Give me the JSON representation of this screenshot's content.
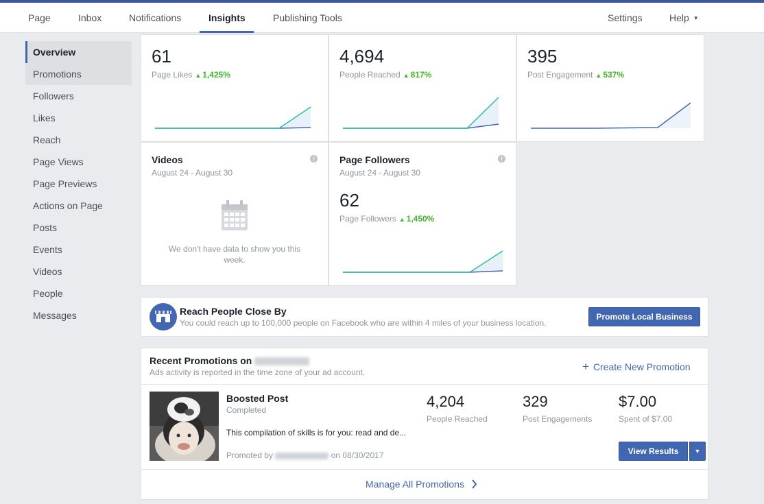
{
  "nav": {
    "items": [
      "Page",
      "Inbox",
      "Notifications",
      "Insights",
      "Publishing Tools"
    ],
    "right": [
      "Settings",
      "Help"
    ]
  },
  "sidebar": {
    "items": [
      "Overview",
      "Promotions",
      "Followers",
      "Likes",
      "Reach",
      "Page Views",
      "Page Previews",
      "Actions on Page",
      "Posts",
      "Events",
      "Videos",
      "People",
      "Messages"
    ]
  },
  "metrics": [
    {
      "value": "61",
      "label": "Page Likes",
      "change": "1,425%"
    },
    {
      "value": "4,694",
      "label": "People Reached",
      "change": "817%"
    },
    {
      "value": "395",
      "label": "Post Engagement",
      "change": "537%"
    }
  ],
  "videos": {
    "title": "Videos",
    "date_range": "August 24 - August 30",
    "empty_line1": "We don't have data to show you this",
    "empty_line2": "week."
  },
  "followers": {
    "title": "Page Followers",
    "date_range": "August 24 - August 30",
    "value": "62",
    "label": "Page Followers",
    "change": "1,450%"
  },
  "local_business": {
    "title": "Reach People Close By",
    "description": "You could reach up to 100,000 people on Facebook who are within 4 miles of your business location.",
    "button": "Promote Local Business"
  },
  "promotions": {
    "title": "Recent Promotions on",
    "subtitle": "Ads activity is reported in the time zone of your ad account.",
    "create_label": "Create New Promotion",
    "post_type": "Boosted Post",
    "status": "Completed",
    "excerpt": "This compilation of skills is for you: read and de...",
    "promoted_by": "Promoted by",
    "promoted_date": "on 08/30/2017",
    "stats": [
      {
        "value": "4,204",
        "label": "People Reached"
      },
      {
        "value": "329",
        "label": "Post Engagements"
      },
      {
        "value": "$7.00",
        "label": "Spent of $7.00"
      }
    ],
    "view_results": "View Results",
    "manage_all": "Manage All Promotions"
  },
  "colors": {
    "brand": "#4267b2",
    "positive": "#42b72a",
    "spark_green": "#2bbfa0",
    "spark_blue": "#4267b2"
  },
  "icons": [
    "calendar-icon",
    "storefront-icon",
    "info-icon",
    "plus-icon",
    "chevron-right-icon",
    "caret-down-icon"
  ]
}
